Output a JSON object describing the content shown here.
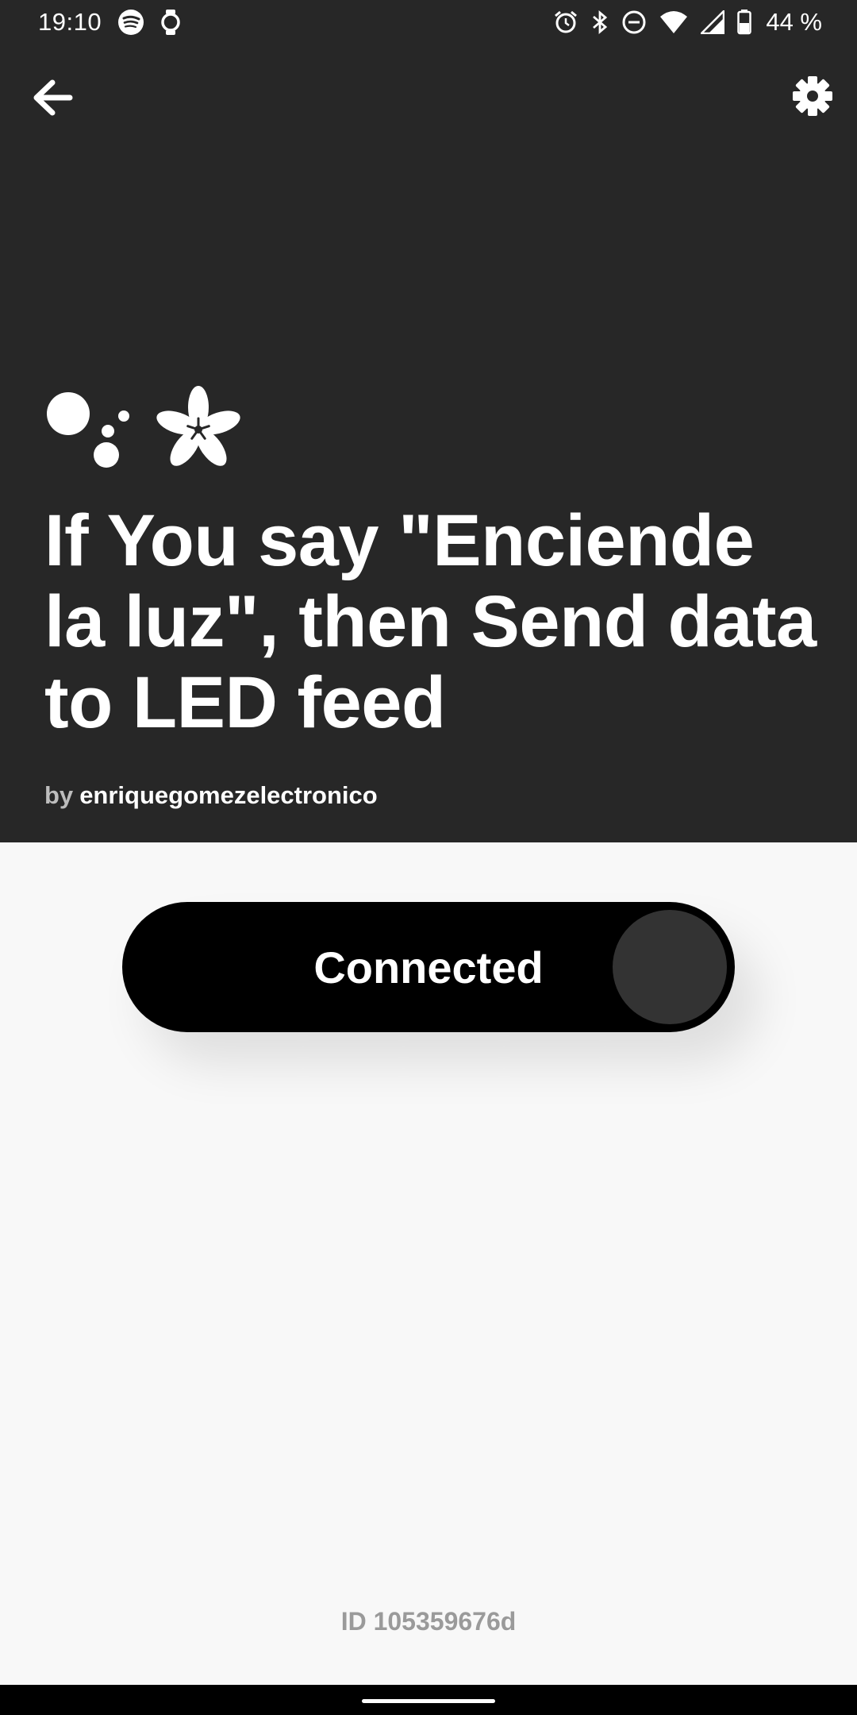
{
  "status_bar": {
    "time": "19:10",
    "battery": "44 %",
    "icons_left": [
      "spotify-icon",
      "watch-icon"
    ],
    "icons_right": [
      "alarm-icon",
      "bluetooth-icon",
      "do-not-disturb-icon",
      "wifi-icon",
      "signal-icon",
      "battery-icon"
    ]
  },
  "header": {
    "background": "#272727",
    "title": "If You say \"Enciende la luz\", then Send data to LED feed",
    "byline_prefix": "by",
    "author": "enriquegomezelectronico",
    "service_icons": [
      "google-assistant-icon",
      "adafruit-icon"
    ]
  },
  "toggle": {
    "label": "Connected",
    "state": "on"
  },
  "footer": {
    "applet_id": "ID 105359676d"
  }
}
